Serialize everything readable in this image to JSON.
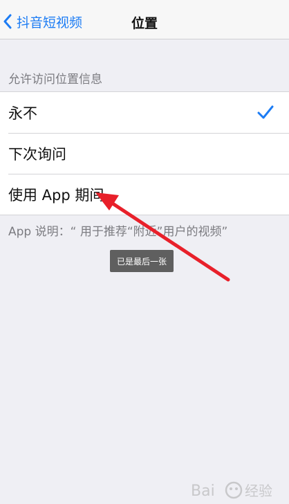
{
  "nav": {
    "back_label": "抖音短视频",
    "title": "位置"
  },
  "section": {
    "header": "允许访问位置信息"
  },
  "options": [
    {
      "label": "永不",
      "selected": true
    },
    {
      "label": "下次询问",
      "selected": false
    },
    {
      "label": "使用 App 期间",
      "selected": false
    }
  ],
  "footer_note": "App 说明：“ 用于推荐“附近”用户的视频”",
  "toast": "已是最后一张",
  "colors": {
    "accent": "#1c7cf4",
    "annotation_arrow": "#e8202a",
    "background": "#efeff4"
  },
  "icons": {
    "back": "chevron-left-icon",
    "selected": "checkmark-icon"
  },
  "watermark": {
    "text": "Bai 经验"
  }
}
